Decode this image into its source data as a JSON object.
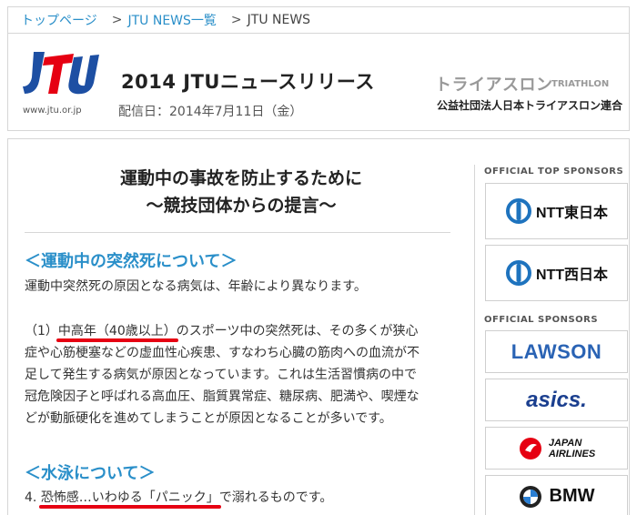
{
  "breadcrumb": {
    "items": [
      "トップページ",
      "JTU NEWS一覧"
    ],
    "separator": ">",
    "current": "JTU NEWS"
  },
  "header": {
    "logo_url": "www.jtu.or.jp",
    "release_title": "2014 JTUニュースリリース",
    "release_date": "配信日：2014年7月11日（金）",
    "triathlon_jp": "トライアスロン",
    "triathlon_en": "TRIATHLON",
    "federation": "公益社団法人日本トライアスロン連合"
  },
  "article": {
    "title_line1": "運動中の事故を防止するために",
    "title_line2": "～競技団体からの提言～",
    "section1_heading": "＜運動中の突然死について＞",
    "section1_intro": "運動中突然死の原因となる病気は、年齢により異なります。",
    "para_prefix": "（1）",
    "para_highlight": "中高年（40歳以上）",
    "para_rest1": "のスポーツ中の突然死は、その多くが狭心",
    "para_line2": "症や心筋梗塞などの虚血性心疾患、すなわち心臓の筋肉への血流が不",
    "para_line3": "足して発生する病気が原因となっています。これは生活習慣病の中で",
    "para_line4": "冠危険因子と呼ばれる高血圧、脂質異常症、糖尿病、肥満や、喫煙な",
    "para_line5": "どが動脈硬化を進めてしまうことが原因となることが多いです。",
    "section2_heading": "＜水泳について＞",
    "swim_prefix": "4. ",
    "swim_highlight": "恐怖感…いわゆる「パニック」",
    "swim_rest": "で溺れるものです。"
  },
  "sidebar": {
    "top_label": "OFFICIAL TOP SPONSORS",
    "official_label": "OFFICIAL SPONSORS",
    "ntt_east": "NTT東日本",
    "ntt_west": "NTT西日本",
    "lawson": "LAWSON",
    "asics": "asics.",
    "jal_line1": "JAPAN",
    "jal_line2": "AIRLINES",
    "bmw": "BMW"
  },
  "colors": {
    "link_blue": "#2a8fc9",
    "underline_red": "#e60012",
    "jtu_red": "#e60012",
    "jtu_blue": "#1d4fa3"
  }
}
